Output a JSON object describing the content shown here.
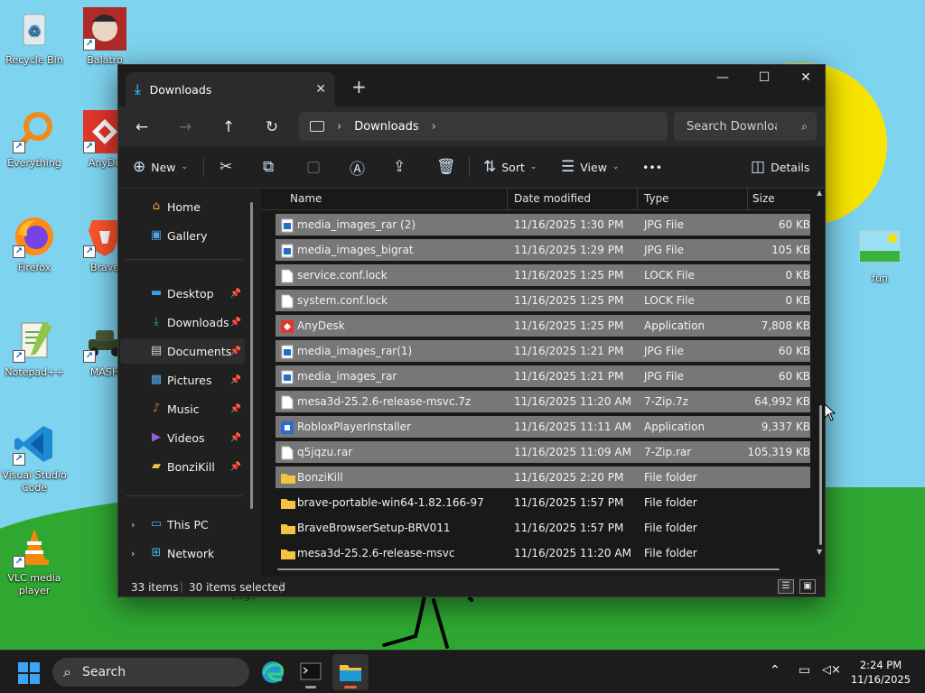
{
  "desktop": {
    "icons": [
      {
        "label": "Recycle Bin"
      },
      {
        "label": "Balatro"
      },
      {
        "label": "Everything"
      },
      {
        "label": "AnyDe"
      },
      {
        "label": "Firefox"
      },
      {
        "label": "Brave"
      },
      {
        "label": "Notepad++"
      },
      {
        "label": "MASH"
      },
      {
        "label": "Visual Studio Code"
      },
      {
        "label": "VLC media player"
      },
      {
        "label": "fun"
      },
      {
        "label": "Edge"
      }
    ]
  },
  "window": {
    "tab_title": "Downloads",
    "breadcrumb": [
      "Downloads"
    ],
    "search_placeholder": "Search Downloa",
    "toolbar": {
      "new_label": "New",
      "sort_label": "Sort",
      "view_label": "View",
      "more_label": "•••",
      "details_label": "Details"
    },
    "nav": {
      "items": [
        {
          "label": "Home",
          "icon": "home-icon"
        },
        {
          "label": "Gallery",
          "icon": "gallery-icon"
        },
        {
          "label": "Desktop",
          "icon": "desktop-icon"
        },
        {
          "label": "Downloads",
          "icon": "download-icon"
        },
        {
          "label": "Documents",
          "icon": "document-icon"
        },
        {
          "label": "Pictures",
          "icon": "pictures-icon"
        },
        {
          "label": "Music",
          "icon": "music-icon"
        },
        {
          "label": "Videos",
          "icon": "videos-icon"
        },
        {
          "label": "BonziKill",
          "icon": "folder-icon"
        },
        {
          "label": "This PC",
          "icon": "pc-icon"
        },
        {
          "label": "Network",
          "icon": "network-icon"
        }
      ]
    },
    "columns": {
      "name": "Name",
      "date": "Date modified",
      "type": "Type",
      "size": "Size"
    },
    "files": [
      {
        "name": "media_images_rar (2)",
        "date": "11/16/2025 1:30 PM",
        "type": "JPG File",
        "size": "60 KB",
        "kind": "jpg",
        "selected": true
      },
      {
        "name": "media_images_bigrat",
        "date": "11/16/2025 1:29 PM",
        "type": "JPG File",
        "size": "105 KB",
        "kind": "jpg",
        "selected": true
      },
      {
        "name": "service.conf.lock",
        "date": "11/16/2025 1:25 PM",
        "type": "LOCK File",
        "size": "0 KB",
        "kind": "file",
        "selected": true
      },
      {
        "name": "system.conf.lock",
        "date": "11/16/2025 1:25 PM",
        "type": "LOCK File",
        "size": "0 KB",
        "kind": "file",
        "selected": true
      },
      {
        "name": "AnyDesk",
        "date": "11/16/2025 1:25 PM",
        "type": "Application",
        "size": "7,808 KB",
        "kind": "anydesk",
        "selected": true
      },
      {
        "name": "media_images_rar(1)",
        "date": "11/16/2025 1:21 PM",
        "type": "JPG File",
        "size": "60 KB",
        "kind": "jpg",
        "selected": true
      },
      {
        "name": "media_images_rar",
        "date": "11/16/2025 1:21 PM",
        "type": "JPG File",
        "size": "60 KB",
        "kind": "jpg",
        "selected": true
      },
      {
        "name": "mesa3d-25.2.6-release-msvc.7z",
        "date": "11/16/2025 11:20 AM",
        "type": "7-Zip.7z",
        "size": "64,992 KB",
        "kind": "file",
        "selected": true
      },
      {
        "name": "RobloxPlayerInstaller",
        "date": "11/16/2025 11:11 AM",
        "type": "Application",
        "size": "9,337 KB",
        "kind": "roblox",
        "selected": true
      },
      {
        "name": "q5jqzu.rar",
        "date": "11/16/2025 11:09 AM",
        "type": "7-Zip.rar",
        "size": "105,319 KB",
        "kind": "file",
        "selected": true
      },
      {
        "name": "BonziKill",
        "date": "11/16/2025 2:20 PM",
        "type": "File folder",
        "size": "",
        "kind": "folder",
        "selected": true
      },
      {
        "name": "brave-portable-win64-1.82.166-97",
        "date": "11/16/2025 1:57 PM",
        "type": "File folder",
        "size": "",
        "kind": "folder",
        "selected": false
      },
      {
        "name": "BraveBrowserSetup-BRV011",
        "date": "11/16/2025 1:57 PM",
        "type": "File folder",
        "size": "",
        "kind": "folder",
        "selected": false
      },
      {
        "name": "mesa3d-25.2.6-release-msvc",
        "date": "11/16/2025 11:20 AM",
        "type": "File folder",
        "size": "",
        "kind": "folder",
        "selected": false
      }
    ],
    "status": {
      "items": "33 items",
      "selected": "30 items selected"
    }
  },
  "taskbar": {
    "search_label": "Search",
    "time": "2:24 PM",
    "date": "11/16/2025"
  }
}
